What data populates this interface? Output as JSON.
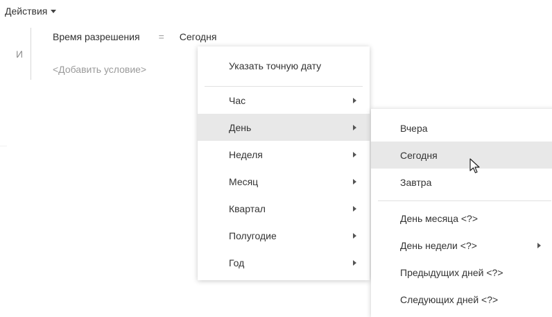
{
  "toolbar": {
    "actions_label": "Действия"
  },
  "filter": {
    "operator": "И",
    "condition": {
      "field": "Время разрешения",
      "op": "=",
      "value": "Сегодня"
    },
    "add_condition": "<Добавить условие>"
  },
  "menu": {
    "top_item": "Указать точную дату",
    "items": [
      {
        "label": "Час"
      },
      {
        "label": "День"
      },
      {
        "label": "Неделя"
      },
      {
        "label": "Месяц"
      },
      {
        "label": "Квартал"
      },
      {
        "label": "Полугодие"
      },
      {
        "label": "Год"
      }
    ],
    "highlighted": "День"
  },
  "submenu": {
    "items": [
      {
        "label": "Вчера"
      },
      {
        "label": "Сегодня"
      },
      {
        "label": "Завтра"
      }
    ],
    "extra_items": [
      {
        "label": "День месяца <?>"
      },
      {
        "label": "День недели <?>"
      },
      {
        "label": "Предыдущих дней <?>"
      },
      {
        "label": "Следующих дней <?>"
      }
    ],
    "highlighted": "Сегодня"
  },
  "colors": {
    "highlight": "#e8e8e8",
    "text": "#333333",
    "muted": "#9a9a9a"
  }
}
